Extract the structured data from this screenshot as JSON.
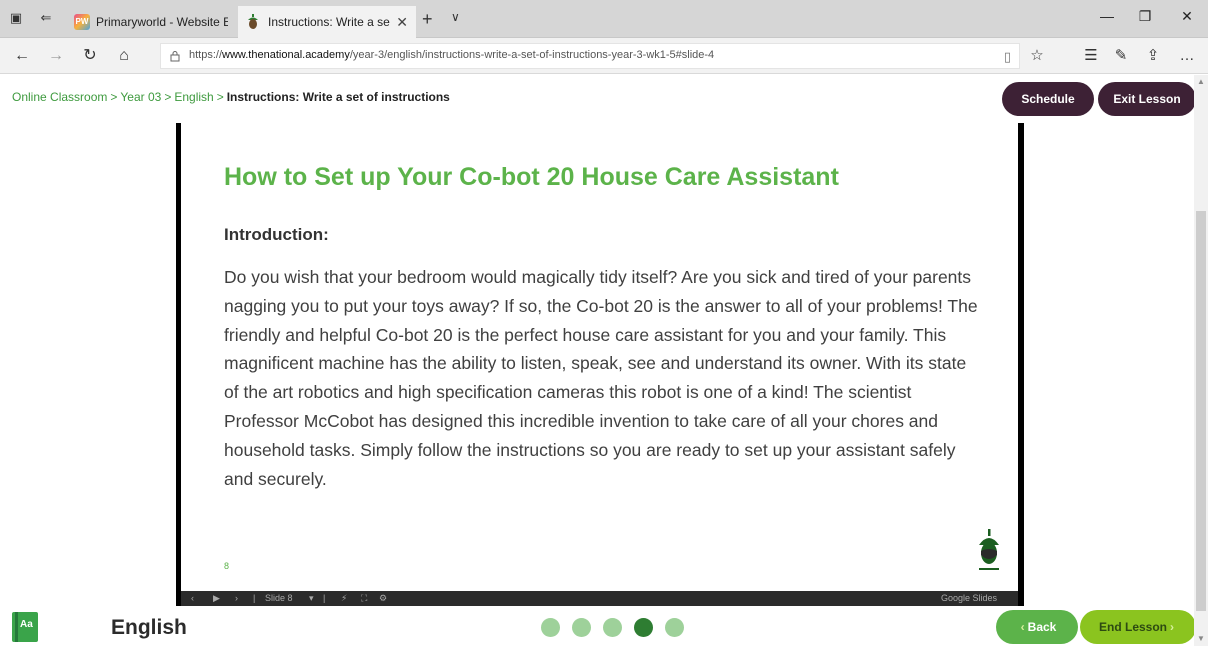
{
  "browser": {
    "tabs": [
      {
        "title": "Primaryworld - Website Edit",
        "favicon": "pw",
        "active": false
      },
      {
        "title": "Instructions: Write a set",
        "favicon": "acorn",
        "active": true
      }
    ],
    "url_prefix": "https://",
    "url_domain": "www.thenational.academy",
    "url_path": "/year-3/english/instructions-write-a-set-of-instructions-year-3-wk1-5#slide-4"
  },
  "breadcrumb": {
    "items": [
      "Online Classroom",
      "Year 03",
      "English"
    ],
    "current": "Instructions: Write a set of instructions",
    "separator": ">"
  },
  "header": {
    "schedule_label": "Schedule",
    "exit_label": "Exit Lesson"
  },
  "slide": {
    "title": "How to Set up Your Co-bot 20 House Care Assistant",
    "subtitle": "Introduction:",
    "body": "Do you wish that your bedroom would magically tidy itself? Are you sick and tired of your parents nagging you to put your toys away? If so, the Co-bot 20 is the answer to all of your problems!  The friendly and helpful Co-bot 20 is the perfect house care assistant for you and your family. This magnificent machine has the ability to listen, speak, see and understand its owner. With its state of the art robotics and high specification cameras this robot is one of a kind! The scientist Professor McCobot has designed this incredible invention to take care of all your chores and household tasks. Simply follow the instructions so you are ready to set up your assistant safely and securely.",
    "page_number": "8",
    "controls_slide_label": "Slide 8",
    "provider": "Google Slides"
  },
  "footer": {
    "subject": "English",
    "book_icon_text": "Aa",
    "progress": {
      "total": 5,
      "current": 4
    },
    "back_label": "Back",
    "end_label": "End Lesson"
  },
  "colors": {
    "brand_green": "#5cb34a",
    "dark_purple": "#3d2135",
    "lime": "#8bc41f"
  }
}
